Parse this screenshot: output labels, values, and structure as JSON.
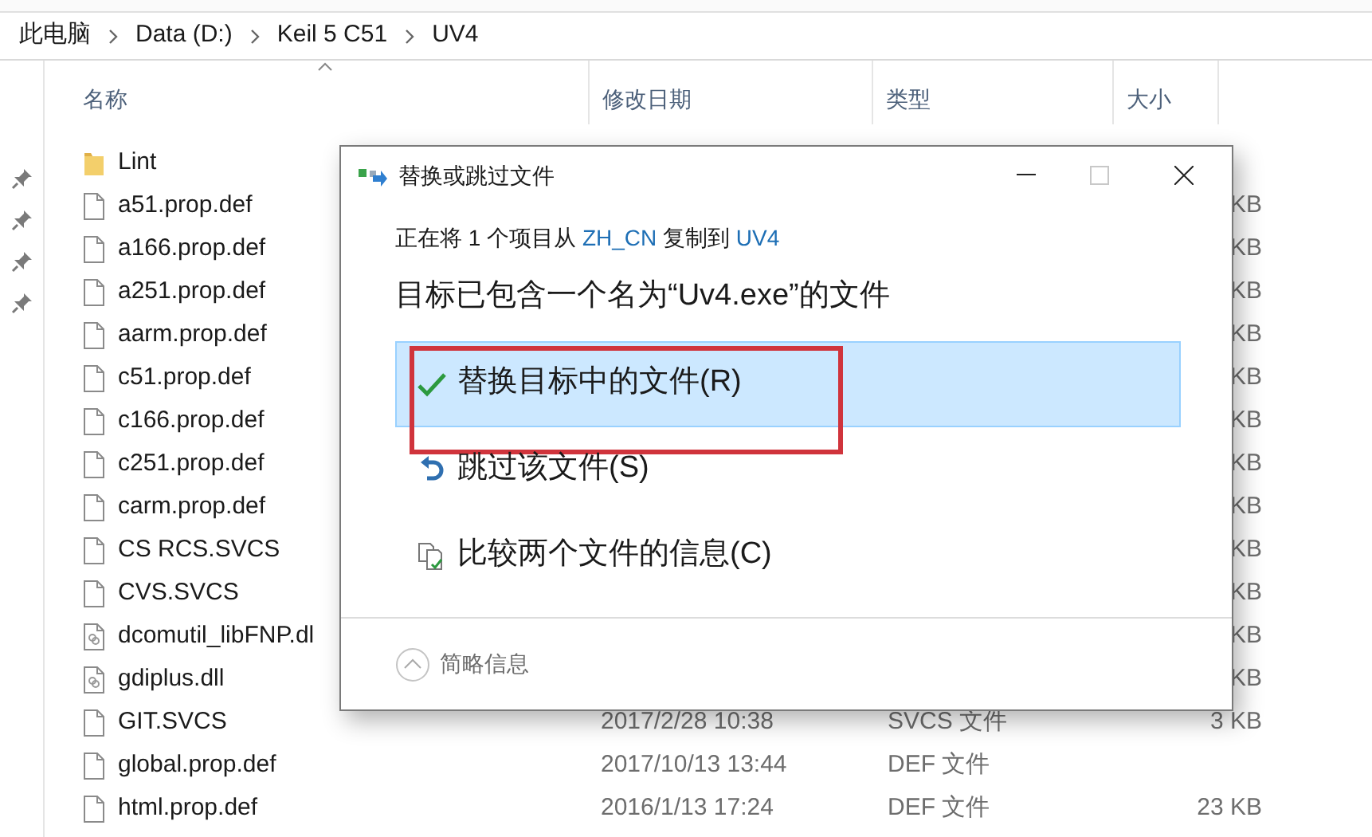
{
  "breadcrumb": [
    "此电脑",
    "Data (D:)",
    "Keil 5 C51",
    "UV4"
  ],
  "columns": [
    {
      "label": "名称",
      "sorted": true
    },
    {
      "label": "修改日期",
      "sorted": false
    },
    {
      "label": "类型",
      "sorted": false
    },
    {
      "label": "大小",
      "sorted": false
    }
  ],
  "files": [
    {
      "kind": "folder",
      "name": "Lint"
    },
    {
      "kind": "file",
      "name": "a51.prop.def",
      "size": "KB"
    },
    {
      "kind": "file",
      "name": "a166.prop.def",
      "size": "KB"
    },
    {
      "kind": "file",
      "name": "a251.prop.def",
      "size": "KB"
    },
    {
      "kind": "file",
      "name": "aarm.prop.def",
      "size": "KB"
    },
    {
      "kind": "file",
      "name": "c51.prop.def",
      "size": "KB"
    },
    {
      "kind": "file",
      "name": "c166.prop.def",
      "size": "KB"
    },
    {
      "kind": "file",
      "name": "c251.prop.def",
      "size": "KB"
    },
    {
      "kind": "file",
      "name": "carm.prop.def",
      "size": "KB"
    },
    {
      "kind": "file",
      "name": "CS RCS.SVCS",
      "size": "KB"
    },
    {
      "kind": "file",
      "name": "CVS.SVCS",
      "size": "KB"
    },
    {
      "kind": "dll",
      "name": "dcomutil_libFNP.dl",
      "size": "KB"
    },
    {
      "kind": "dll",
      "name": "gdiplus.dll",
      "size": "KB"
    },
    {
      "kind": "file",
      "name": "GIT.SVCS",
      "date": "2017/2/28 10:38",
      "type": "SVCS 文件",
      "size": "3 KB"
    },
    {
      "kind": "file",
      "name": "global.prop.def",
      "date": "2017/10/13 13:44",
      "type": "DEF 文件"
    },
    {
      "kind": "file",
      "name": "html.prop.def",
      "date": "2016/1/13 17:24",
      "type": "DEF 文件",
      "size": "23 KB"
    }
  ],
  "dialog": {
    "title": "替换或跳过文件",
    "maximize_disabled": true,
    "copy_line": {
      "prefix": "正在将 1 个项目从",
      "source": "ZH_CN",
      "middle": "复制到",
      "destination": "UV4"
    },
    "heading": "目标已包含一个名为“Uv4.exe”的文件",
    "options": [
      {
        "kind": "replace",
        "label": "替换目标中的文件(R)",
        "selected": true,
        "marked": true
      },
      {
        "kind": "skip",
        "label": "跳过该文件(S)",
        "selected": false,
        "marked": false
      },
      {
        "kind": "compare",
        "label": "比较两个文件的信息(C)",
        "selected": false,
        "marked": false
      }
    ],
    "details_toggle": "简略信息"
  }
}
